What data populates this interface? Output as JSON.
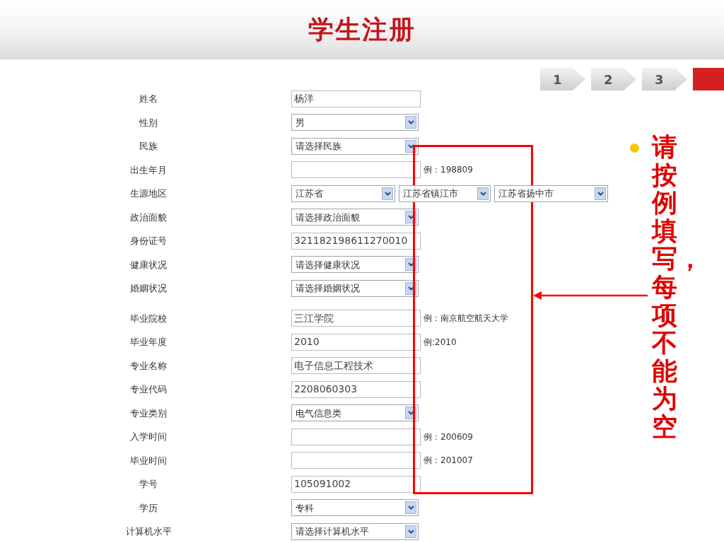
{
  "title": "学生注册",
  "steps": [
    {
      "label": "1",
      "selected": false
    },
    {
      "label": "2",
      "selected": false
    },
    {
      "label": "3",
      "selected": false
    },
    {
      "selected": true
    }
  ],
  "form_sections": [
    {
      "rows": [
        {
          "label": "姓名",
          "kind": "text",
          "value": "杨洋"
        },
        {
          "label": "性别",
          "kind": "select",
          "value": "男"
        },
        {
          "label": "民族",
          "kind": "select",
          "value": "请选择民族"
        },
        {
          "label": "出生年月",
          "kind": "text",
          "hint": "例：198809"
        },
        {
          "label": "生源地区",
          "kind": "region",
          "values": [
            "江苏省",
            "江苏省镇江市",
            "江苏省扬中市"
          ]
        },
        {
          "label": "政治面貌",
          "kind": "select",
          "value": "请选择政治面貌"
        },
        {
          "label": "身份证号",
          "kind": "text",
          "value": "321182198611270010"
        },
        {
          "label": "健康状况",
          "kind": "select",
          "value": "请选择健康状况"
        },
        {
          "label": "婚姻状况",
          "kind": "select",
          "value": "请选择婚姻状况"
        }
      ]
    },
    {
      "rows": [
        {
          "label": "毕业院校",
          "kind": "text",
          "value": "三江学院",
          "hint": "例：南京航空航天大学"
        },
        {
          "label": "毕业年度",
          "kind": "text",
          "value": "2010",
          "hint": "例:2010"
        },
        {
          "label": "专业名称",
          "kind": "text",
          "value": "电子信息工程技术"
        },
        {
          "label": "专业代码",
          "kind": "text",
          "value": "2208060303"
        },
        {
          "label": "专业类别",
          "kind": "select",
          "value": "电气信息类"
        },
        {
          "label": "入学时间",
          "kind": "text",
          "hint": "例：200609"
        },
        {
          "label": "毕业时间",
          "kind": "text",
          "hint": "例：201007"
        },
        {
          "label": "学号",
          "kind": "text",
          "value": "105091002"
        },
        {
          "label": "学历",
          "kind": "select",
          "value": "专科"
        },
        {
          "label": "计算机水平",
          "kind": "select",
          "value": "请选择计算机水平"
        }
      ]
    }
  ],
  "callout": {
    "text": "请按例填写，每项不能为空"
  }
}
